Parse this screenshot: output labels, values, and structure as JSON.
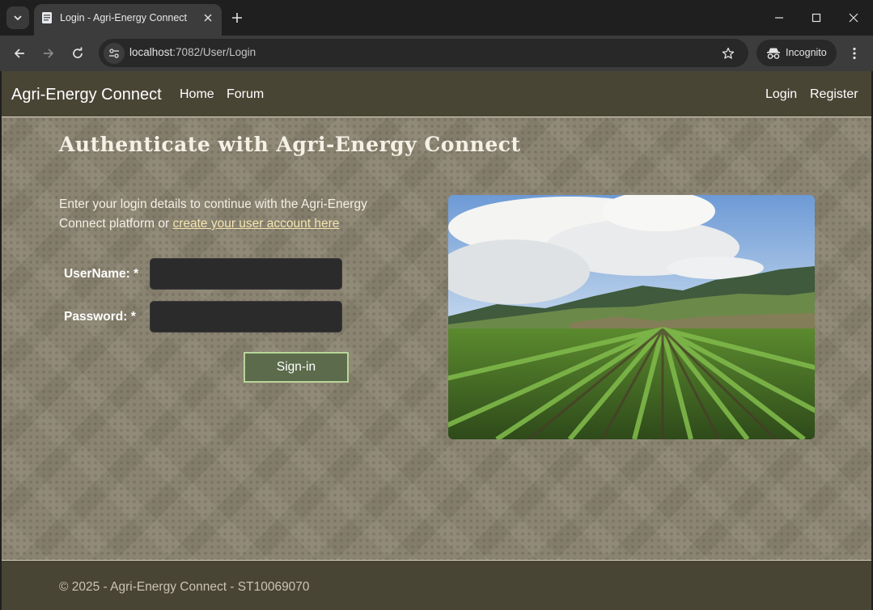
{
  "browser": {
    "tab_title": "Login - Agri-Energy Connect",
    "url_host": "localhost",
    "url_path": ":7082/User/Login",
    "incognito_label": "Incognito"
  },
  "navbar": {
    "brand": "Agri-Energy Connect",
    "links": [
      "Home",
      "Forum"
    ],
    "right_links": [
      "Login",
      "Register"
    ]
  },
  "main": {
    "heading": "Authenticate with Agri-Energy Connect",
    "intro_text": "Enter your login details to continue with the Agri-Energy Connect platform or",
    "intro_link": "create your user account here",
    "username_label": "UserName: *",
    "username_value": "",
    "password_label": "Password: *",
    "password_value": "",
    "signin_label": "Sign-in"
  },
  "footer": {
    "text": "© 2025 - Agri-Energy Connect - ST10069070"
  },
  "colors": {
    "navbar_bg": "#494535",
    "page_bg": "#8b8472",
    "button_bg": "#5b6b4b",
    "button_border": "#b8d59a",
    "link": "#f4e5b0"
  }
}
